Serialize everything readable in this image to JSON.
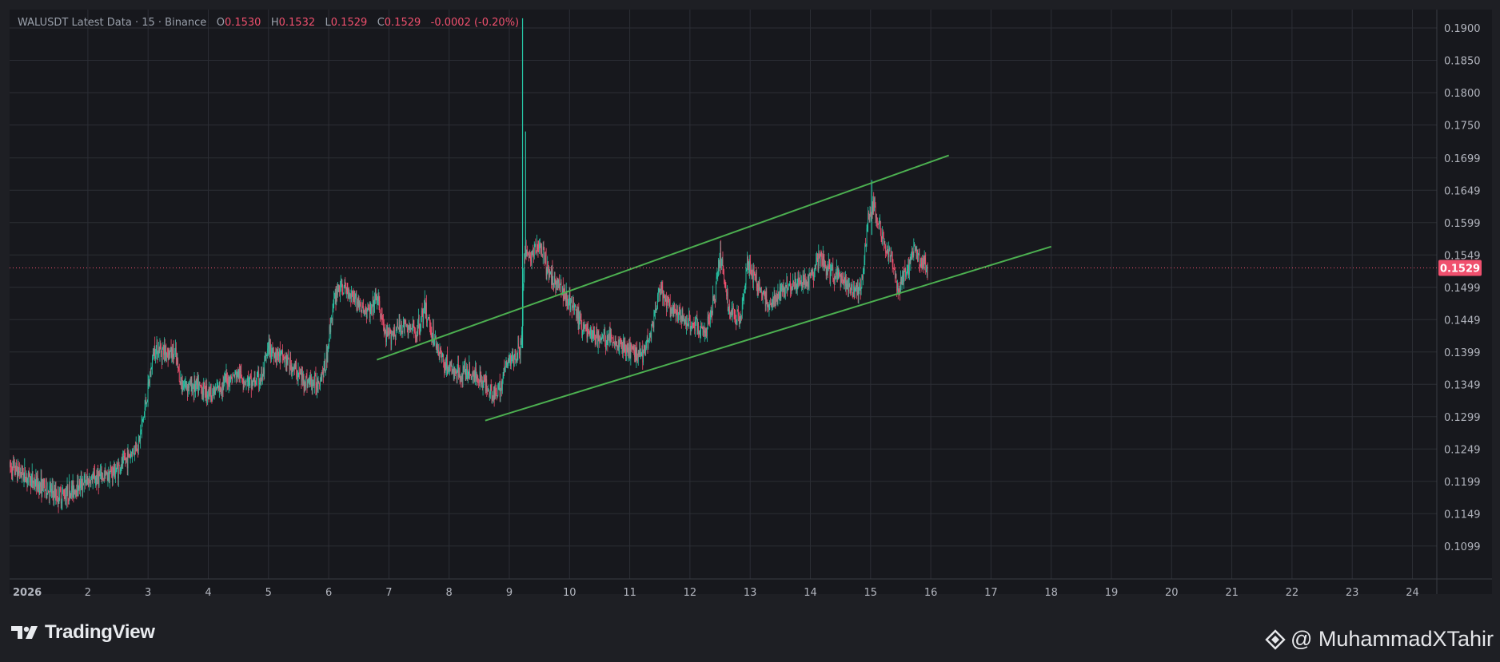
{
  "header": {
    "symbol_line": "WALUSDT Latest Data · 15 · Binance",
    "open_label": "O",
    "open_value": "0.1530",
    "high_label": "H",
    "high_value": "0.1532",
    "low_label": "L",
    "low_value": "0.1529",
    "close_label": "C",
    "close_value": "0.1529",
    "change": "-0.0002 (-0.20%)"
  },
  "price_tag": "0.1529",
  "brand": {
    "name": "TradingView"
  },
  "watermark": {
    "handle": "@ MuhammadXTahir"
  },
  "colors": {
    "background": "#1e1f24",
    "grid": "#2c2e35",
    "up_candle": "#26c6a6",
    "down_candle": "#f0506e",
    "trendline": "#4caf50",
    "price_tag": "#f0506e",
    "text": "#b2b5be"
  },
  "chart_data": {
    "type": "candlestick",
    "timeframe": "15",
    "exchange": "Binance",
    "x_tick_labels": [
      "2026",
      "2",
      "3",
      "4",
      "5",
      "6",
      "7",
      "8",
      "9",
      "10",
      "11",
      "12",
      "13",
      "14",
      "15",
      "16",
      "17",
      "18",
      "19",
      "20",
      "21",
      "22",
      "23",
      "24"
    ],
    "y_tick_labels": [
      "0.1900",
      "0.1850",
      "0.1800",
      "0.1750",
      "0.1699",
      "0.1649",
      "0.1599",
      "0.1549",
      "0.1499",
      "0.1449",
      "0.1399",
      "0.1349",
      "0.1299",
      "0.1249",
      "0.1199",
      "0.1149",
      "0.1099"
    ],
    "ylim": [
      0.105,
      0.1915
    ],
    "xlim": [
      0.7,
      24.6
    ],
    "last_price": 0.1529,
    "price_path": [
      [
        0.7,
        0.1222
      ],
      [
        0.9,
        0.1212
      ],
      [
        1.1,
        0.1198
      ],
      [
        1.3,
        0.1188
      ],
      [
        1.5,
        0.1176
      ],
      [
        1.7,
        0.1183
      ],
      [
        1.9,
        0.1196
      ],
      [
        2.1,
        0.1203
      ],
      [
        2.3,
        0.1208
      ],
      [
        2.5,
        0.1218
      ],
      [
        2.7,
        0.124
      ],
      [
        2.85,
        0.126
      ],
      [
        3.0,
        0.134
      ],
      [
        3.1,
        0.1405
      ],
      [
        3.3,
        0.14
      ],
      [
        3.45,
        0.1395
      ],
      [
        3.55,
        0.135
      ],
      [
        3.8,
        0.1345
      ],
      [
        4.1,
        0.1336
      ],
      [
        4.3,
        0.1355
      ],
      [
        4.5,
        0.1365
      ],
      [
        4.7,
        0.135
      ],
      [
        4.9,
        0.136
      ],
      [
        5.0,
        0.1405
      ],
      [
        5.3,
        0.1385
      ],
      [
        5.6,
        0.1355
      ],
      [
        5.8,
        0.135
      ],
      [
        5.95,
        0.1378
      ],
      [
        6.05,
        0.1458
      ],
      [
        6.15,
        0.15
      ],
      [
        6.4,
        0.149
      ],
      [
        6.55,
        0.1465
      ],
      [
        6.7,
        0.146
      ],
      [
        6.8,
        0.1485
      ],
      [
        6.95,
        0.142
      ],
      [
        7.2,
        0.144
      ],
      [
        7.45,
        0.143
      ],
      [
        7.6,
        0.1465
      ],
      [
        7.75,
        0.142
      ],
      [
        7.9,
        0.1385
      ],
      [
        8.1,
        0.1365
      ],
      [
        8.3,
        0.1368
      ],
      [
        8.5,
        0.136
      ],
      [
        8.7,
        0.134
      ],
      [
        8.8,
        0.133
      ],
      [
        8.95,
        0.138
      ],
      [
        9.1,
        0.1395
      ],
      [
        9.2,
        0.1405
      ],
      [
        9.25,
        0.156
      ],
      [
        9.35,
        0.1545
      ],
      [
        9.5,
        0.1565
      ],
      [
        9.65,
        0.152
      ],
      [
        9.8,
        0.1505
      ],
      [
        10.0,
        0.148
      ],
      [
        10.2,
        0.144
      ],
      [
        10.45,
        0.142
      ],
      [
        10.7,
        0.142
      ],
      [
        11.0,
        0.14
      ],
      [
        11.2,
        0.1395
      ],
      [
        11.35,
        0.143
      ],
      [
        11.5,
        0.1495
      ],
      [
        11.7,
        0.146
      ],
      [
        11.9,
        0.145
      ],
      [
        12.1,
        0.144
      ],
      [
        12.25,
        0.1425
      ],
      [
        12.4,
        0.148
      ],
      [
        12.5,
        0.1555
      ],
      [
        12.65,
        0.146
      ],
      [
        12.85,
        0.1455
      ],
      [
        12.95,
        0.1535
      ],
      [
        13.15,
        0.15
      ],
      [
        13.3,
        0.147
      ],
      [
        13.45,
        0.148
      ],
      [
        13.6,
        0.1505
      ],
      [
        13.8,
        0.1505
      ],
      [
        14.0,
        0.151
      ],
      [
        14.15,
        0.1545
      ],
      [
        14.3,
        0.1525
      ],
      [
        14.5,
        0.151
      ],
      [
        14.7,
        0.1495
      ],
      [
        14.85,
        0.15
      ],
      [
        14.95,
        0.16
      ],
      [
        15.05,
        0.163
      ],
      [
        15.2,
        0.157
      ],
      [
        15.35,
        0.154
      ],
      [
        15.45,
        0.15
      ],
      [
        15.6,
        0.152
      ],
      [
        15.7,
        0.1555
      ],
      [
        15.85,
        0.154
      ],
      [
        15.95,
        0.1529
      ]
    ],
    "wicks": [
      {
        "x": 9.22,
        "low": 0.1405,
        "high": 0.1915
      },
      {
        "x": 9.27,
        "low": 0.1545,
        "high": 0.174
      },
      {
        "x": 15.02,
        "low": 0.158,
        "high": 0.1665
      }
    ],
    "trendlines": [
      {
        "name": "upper-channel",
        "x1": 6.8,
        "y1": 0.1387,
        "x2": 16.3,
        "y2": 0.1703
      },
      {
        "name": "lower-channel",
        "x1": 8.6,
        "y1": 0.1293,
        "x2": 18.0,
        "y2": 0.1562
      }
    ],
    "grid": true
  }
}
